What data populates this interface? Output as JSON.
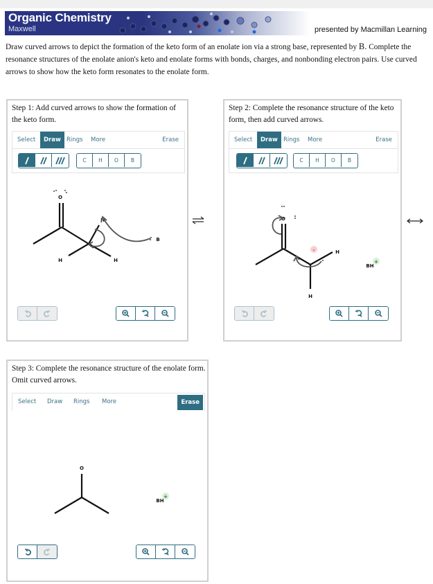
{
  "header": {
    "title": "Organic Chemistry",
    "subtitle": "Maxwell",
    "presented_by": "presented by Macmillan Learning"
  },
  "instructions": {
    "part1": "Draw curved arrows to depict the formation of the keto form of an enolate ion via a strong base, represented by ",
    "base_letter": "B.",
    "part2": " Complete the resonance structures of the enolate anion's keto and enolate forms with bonds, charges, and nonbonding electron pairs. Use curved arrows to show how the keto form resonates to the enolate form."
  },
  "toolbar_labels": {
    "select": "Select",
    "draw": "Draw",
    "rings": "Rings",
    "more": "More",
    "erase": "Erase"
  },
  "atoms": [
    "C",
    "H",
    "O",
    "B"
  ],
  "bond_tools": [
    "single-bond",
    "double-bond",
    "triple-bond"
  ],
  "steps": [
    {
      "label": "Step 1: Add curved arrows to show the formation of the keto form.",
      "active_tool": "Draw",
      "molecule": {
        "atoms": {
          "O": "O",
          "H1": "H",
          "H2": "H",
          "H3": "H",
          "B": "B"
        }
      },
      "undo_enabled": false,
      "redo_enabled": false
    },
    {
      "label": "Step 2: Complete the resonance structure of the keto form, then add curved arrows.",
      "active_tool": "Draw",
      "molecule": {
        "atoms": {
          "O": "O",
          "H1": "H",
          "H2": "H",
          "BH": "BH",
          "charge_minus": "-",
          "charge_plus": "+"
        }
      },
      "undo_enabled": false,
      "redo_enabled": false
    },
    {
      "label": "Step 3: Complete the resonance structure of the enolate form. Omit curved arrows.",
      "active_tool": "Erase",
      "molecule": {
        "atoms": {
          "O": "O",
          "BH": "BH",
          "charge_plus": "+"
        }
      },
      "undo_enabled": true,
      "redo_enabled": false
    }
  ],
  "arrows": {
    "equilibrium": "⇌",
    "resonance": "⟷"
  }
}
